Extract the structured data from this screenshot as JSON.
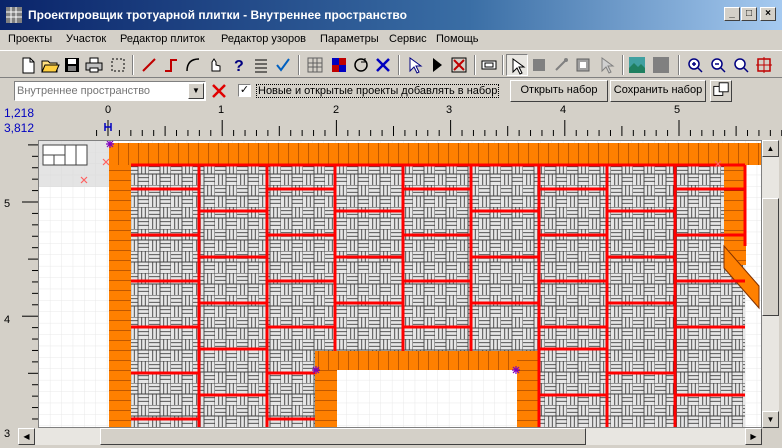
{
  "window": {
    "title": "Проектировщик тротуарной плитки - Внутреннее пространство",
    "minimize": "_",
    "maximize": "□",
    "close": "×"
  },
  "menu": [
    "Проекты",
    "Участок",
    "Редактор плиток",
    "Редактор узоров",
    "Параметры",
    "Сервис",
    "Помощь"
  ],
  "toolbar": {
    "icons": [
      "new-file-icon",
      "open-folder-icon",
      "save-icon",
      "print-icon",
      "select-rect-icon",
      "line-icon",
      "polyline-icon",
      "arc-icon",
      "hand-cursor-icon",
      "help-cursor-icon",
      "numbered-list-icon",
      "checkmark-icon",
      "grid-icon",
      "pattern-icon",
      "rotate-icon",
      "delete-x-icon",
      "pointer-tile-icon",
      "play-icon",
      "delete-frame-icon",
      "eraser-icon",
      "arrow-cursor-icon",
      "gray-tile-icon",
      "move-node-icon",
      "gray-tile-2-icon",
      "arrow-gray-icon",
      "landscape-icon",
      "texture-icon",
      "zoom-in-icon",
      "zoom-out-icon",
      "zoom-fit-icon",
      "zoom-rect-icon"
    ]
  },
  "row2": {
    "set_name_placeholder": "Внутреннее пространство",
    "checkbox_checked": true,
    "checkbox_label": "Новые и открытые проекты добавлять в набор",
    "open_set_button": "Открыть набор",
    "save_set_button": "Сохранить набор"
  },
  "coords": {
    "x": "1,218",
    "y": "3,812"
  },
  "ruler": {
    "h_labels": [
      "0",
      "1",
      "2",
      "3",
      "4",
      "5"
    ],
    "v_labels": [
      "5",
      "4",
      "3"
    ]
  },
  "colors": {
    "border_tile": "#ff8000",
    "zone_line": "#ff0000",
    "tile_gray": "#e6e6e6",
    "tile_line": "#404040"
  }
}
